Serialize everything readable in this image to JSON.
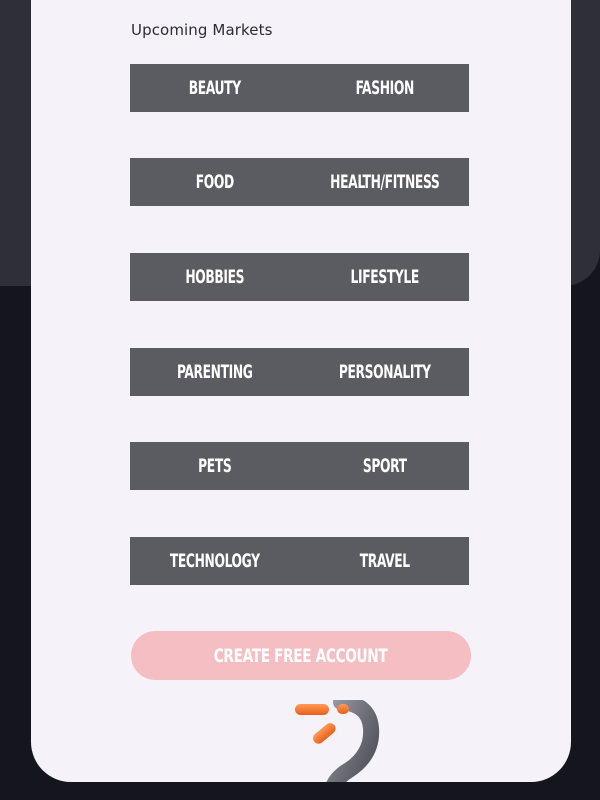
{
  "markets": {
    "title": "Upcoming Markets",
    "rows": [
      [
        "BEAUTY",
        "FASHION"
      ],
      [
        "FOOD",
        "HEALTH/FITNESS"
      ],
      [
        "HOBBIES",
        "LIFESTYLE"
      ],
      [
        "PARENTING",
        "PERSONALITY"
      ],
      [
        "PETS",
        "SPORT"
      ],
      [
        "TECHNOLOGY",
        "TRAVEL"
      ]
    ]
  },
  "cta": {
    "label": "CREATE FREE ACCOUNT"
  },
  "icons": {
    "logo": "orange-sparkle-arc-logo"
  },
  "colors": {
    "page_bg": "#15151d",
    "top_band": "#2f2f38",
    "card": "#f5f3f9",
    "tile": "#5b5b62",
    "cta": "#f5bec2",
    "accent": "#f07a2e"
  }
}
